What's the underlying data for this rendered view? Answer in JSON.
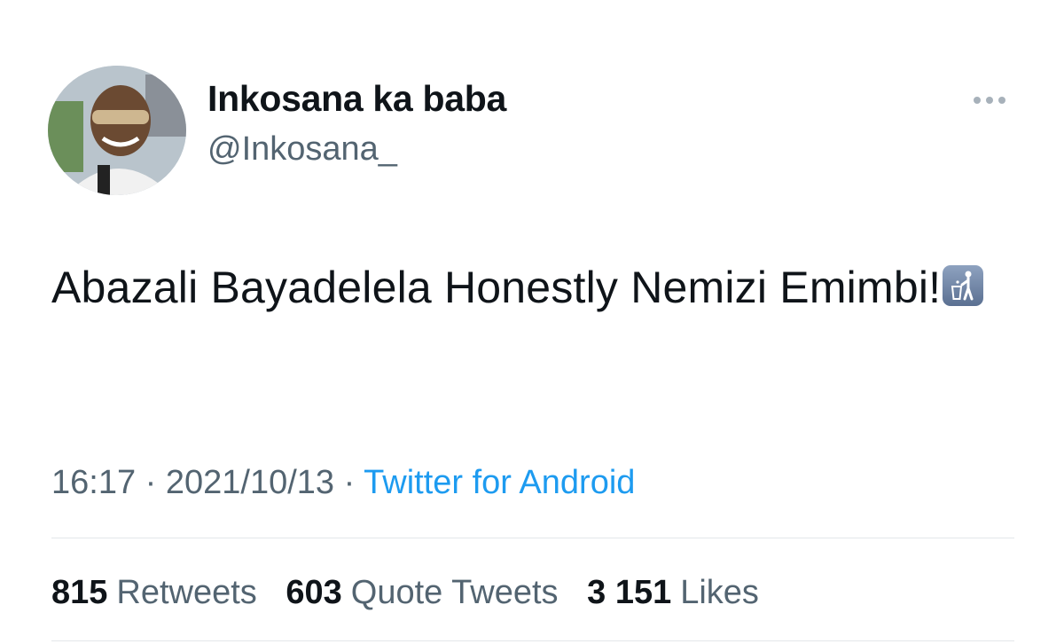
{
  "tweet": {
    "author_name": "Inkosana ka baba",
    "author_handle": "@Inkosana_",
    "text": "Abazali Bayadelela Honestly Nemizi Emimbi!",
    "emoji": "put-litter-in-its-place-icon",
    "time": "16:17",
    "date": "2021/10/13",
    "separator": "·",
    "source": "Twitter for Android"
  },
  "stats": {
    "retweets_count": "815",
    "retweets_label": "Retweets",
    "quotes_count": "603",
    "quotes_label": "Quote Tweets",
    "likes_count": "3 151",
    "likes_label": "Likes"
  },
  "colors": {
    "text": "#0f1419",
    "secondary": "#536471",
    "link": "#1d9bf0",
    "divider": "#e3e7ea"
  }
}
